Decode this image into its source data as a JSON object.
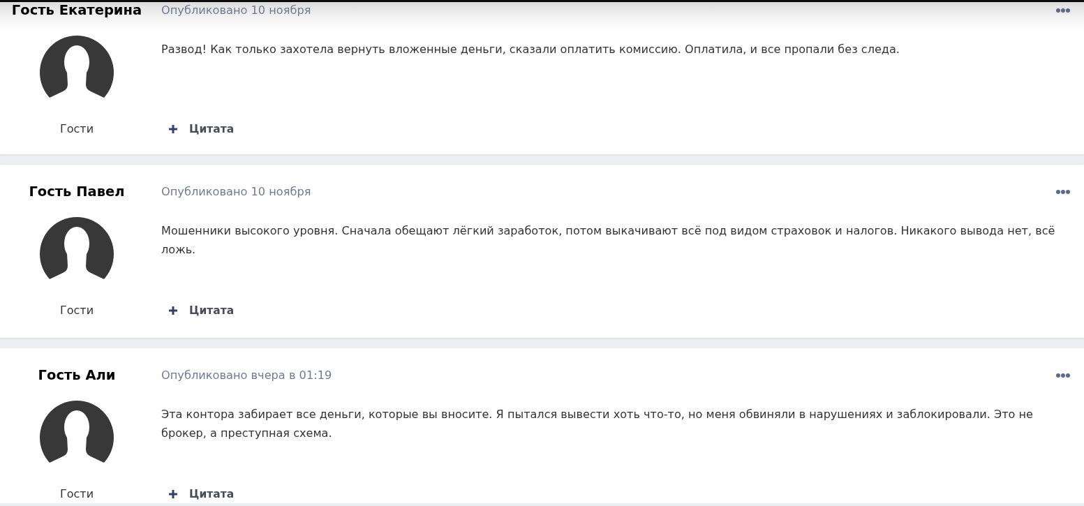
{
  "posts": [
    {
      "author": "Гость Екатерина",
      "published": "Опубликовано 10 ноября",
      "group": "Гости",
      "body": "Развод! Как только захотела вернуть вложенные деньги, сказали оплатить комиссию. Оплатила, и все пропали без следа.",
      "quote_label": "Цитата"
    },
    {
      "author": "Гость Павел",
      "published": "Опубликовано 10 ноября",
      "group": "Гости",
      "body": "Мошенники высокого уровня. Сначала обещают лёгкий заработок, потом выкачивают всё под видом страховок и налогов. Никакого вывода нет, всё ложь.",
      "quote_label": "Цитата"
    },
    {
      "author": "Гость Али",
      "published": "Опубликовано вчера в 01:19",
      "group": "Гости",
      "body": "Эта контора забирает все деньги, которые вы вносите. Я пытался вывести хоть что-то, но меня обвиняли в нарушениях и заблокировали. Это не брокер, а преступная схема.",
      "quote_label": "Цитата"
    }
  ]
}
